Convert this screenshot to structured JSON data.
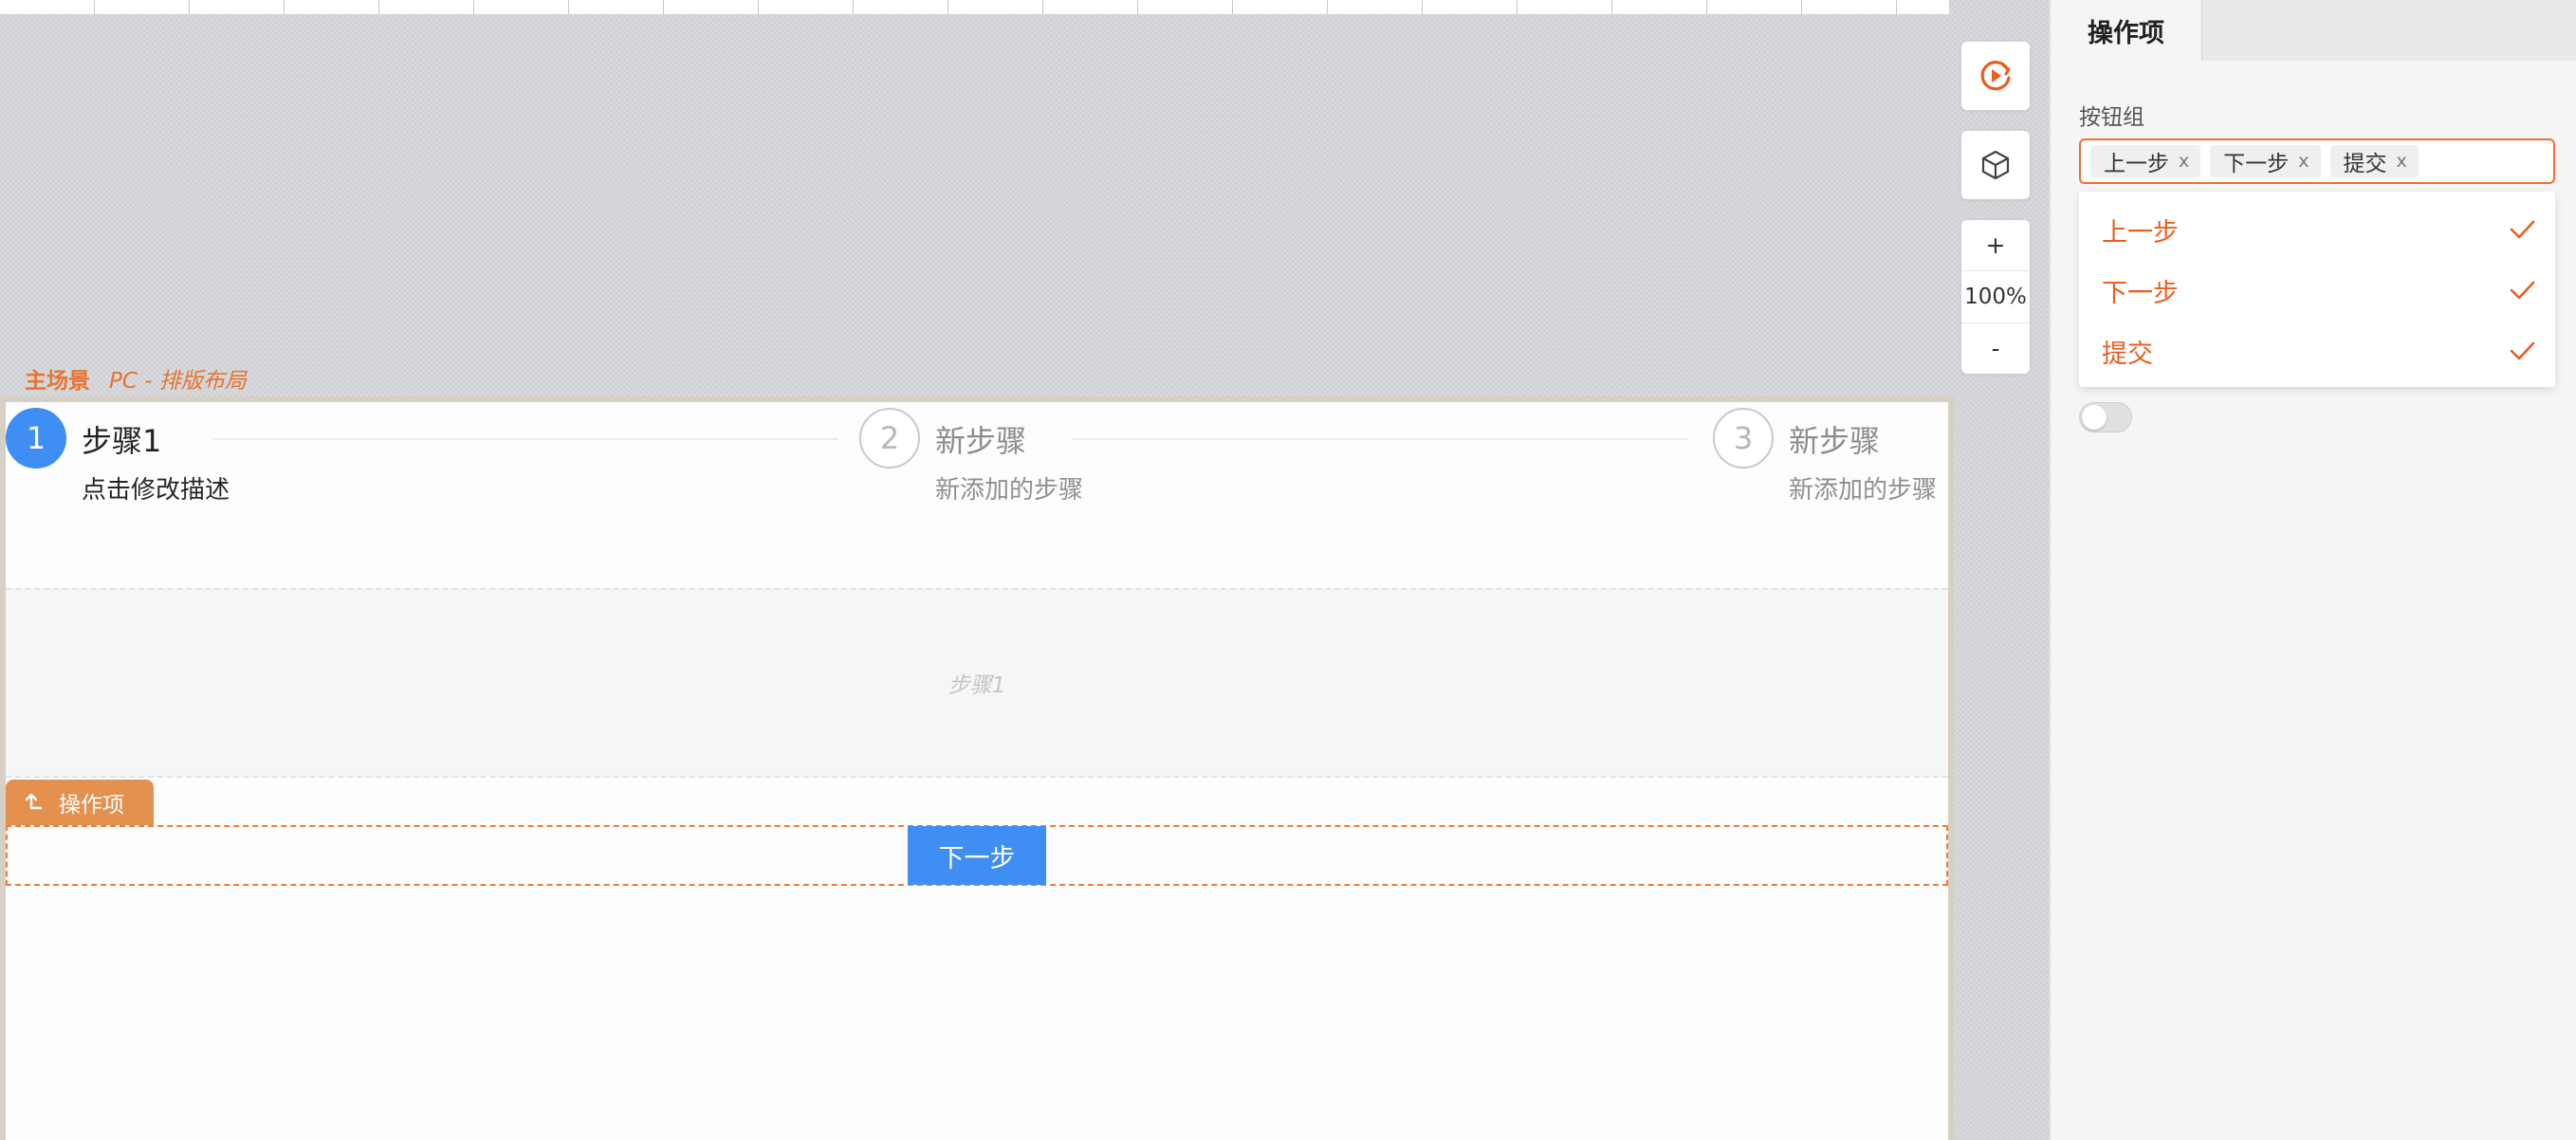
{
  "scene": {
    "main_label": "主场景",
    "sub_label": "PC - 排版布局"
  },
  "steps": [
    {
      "number": "1",
      "title": "步骤1",
      "description": "点击修改描述",
      "active": true
    },
    {
      "number": "2",
      "title": "新步骤",
      "description": "新添加的步骤",
      "active": false
    },
    {
      "number": "3",
      "title": "新步骤",
      "description": "新添加的步骤",
      "active": false
    }
  ],
  "step_content": {
    "placeholder": "步骤1"
  },
  "operations": {
    "tag_label": "操作项",
    "next_button_label": "下一步"
  },
  "toolbar": {
    "preview_icon": "play-circle-icon",
    "component_icon": "cube-icon",
    "zoom_in": "+",
    "zoom_level": "100%",
    "zoom_out": "-"
  },
  "panel": {
    "tab_label": "操作项",
    "button_group_label": "按钮组",
    "selected_tags": [
      "上一步",
      "下一步",
      "提交"
    ],
    "tag_close": "x",
    "options": [
      {
        "label": "上一步",
        "checked": true
      },
      {
        "label": "下一步",
        "checked": true
      },
      {
        "label": "提交",
        "checked": true
      }
    ],
    "toggle_on": false
  },
  "colors": {
    "accent_orange": "#ec5d1f",
    "primary_blue": "#3f8ef3",
    "ops_tag_orange": "#e4904f"
  }
}
